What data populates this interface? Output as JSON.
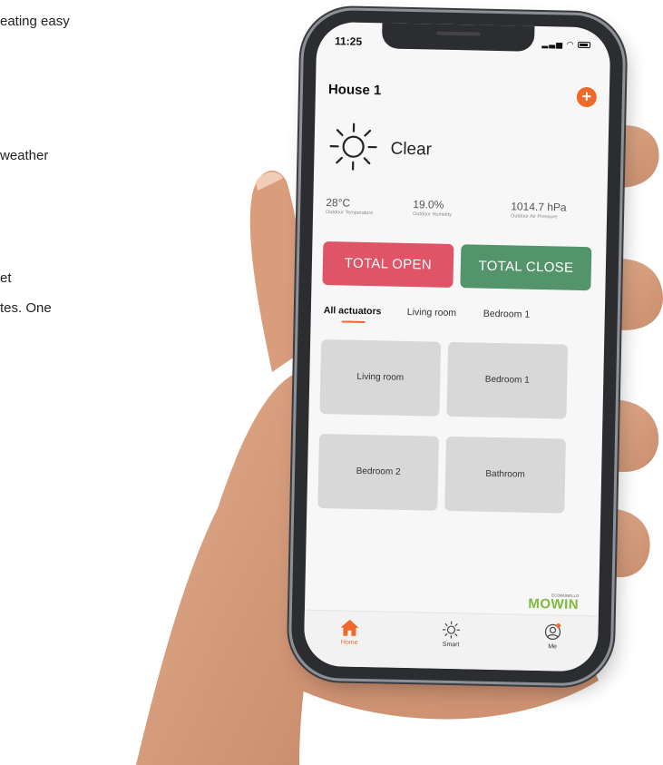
{
  "background_text": {
    "line1": "eating easy",
    "line2": "weather",
    "line3": "et",
    "line4": "tes. One"
  },
  "status_bar": {
    "time": "11:25"
  },
  "header": {
    "title": "House 1",
    "add_label": "+"
  },
  "weather": {
    "condition": "Clear",
    "icon": "sun-icon",
    "metrics": [
      {
        "value": "28°C",
        "label": "Outdoor Temperature"
      },
      {
        "value": "19.0%",
        "label": "Outdoor Humidity"
      },
      {
        "value": "1014.7 hPa",
        "label": "Outdoor Air Pressure"
      }
    ]
  },
  "actions": {
    "open_label": "TOTAL OPEN",
    "close_label": "TOTAL CLOSE",
    "open_color": "#e05467",
    "close_color": "#53946b"
  },
  "tabs": [
    {
      "label": "All actuators",
      "active": true
    },
    {
      "label": "Living room",
      "active": false
    },
    {
      "label": "Bedroom 1",
      "active": false
    }
  ],
  "rooms": [
    {
      "label": "Living room"
    },
    {
      "label": "Bedroom 1"
    },
    {
      "label": "Bedroom 2"
    },
    {
      "label": "Bathroom"
    }
  ],
  "brand": {
    "small": "ECOMUNELLO",
    "big": "MOWIN"
  },
  "bottom_nav": [
    {
      "label": "Home",
      "icon": "home-icon",
      "active": true
    },
    {
      "label": "Smart",
      "icon": "sun-icon",
      "active": false
    },
    {
      "label": "Me",
      "icon": "user-icon",
      "active": false
    }
  ],
  "colors": {
    "accent": "#ef6a2a",
    "brand_green": "#7dbb3c"
  }
}
